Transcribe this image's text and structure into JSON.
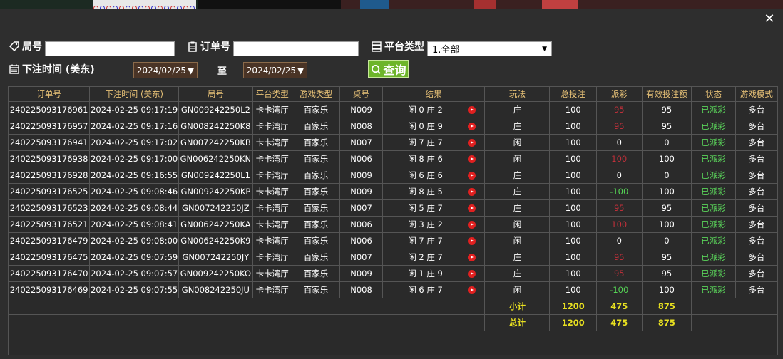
{
  "form": {
    "round_label": "局号",
    "order_label": "订单号",
    "platform_label": "平台类型",
    "platform_value": "1.全部",
    "bet_time_label": "下注时间 (美东)",
    "date_from": "2024/02/25",
    "to_label": "至",
    "date_to": "2024/02/25",
    "query_label": "查询"
  },
  "table": {
    "headers": [
      "订单号",
      "下注时间 (美东)",
      "局号",
      "平台类型",
      "游戏类型",
      "桌号",
      "结果",
      "玩法",
      "总投注",
      "派彩",
      "有效投注额",
      "状态",
      "游戏模式"
    ],
    "rows": [
      {
        "order": "240225093176961",
        "time": "2024-02-25 09:17:19",
        "round": "GN009242250L2",
        "platform": "卡卡湾厅",
        "game": "百家乐",
        "table": "N009",
        "result": "闲 0 庄 2",
        "play": "庄",
        "total": "100",
        "payout": "95",
        "payout_type": "neg",
        "valid": "95",
        "status": "已派彩",
        "mode": "多台"
      },
      {
        "order": "240225093176957",
        "time": "2024-02-25 09:17:16",
        "round": "GN008242250K8",
        "platform": "卡卡湾厅",
        "game": "百家乐",
        "table": "N008",
        "result": "闲 0 庄 9",
        "play": "庄",
        "total": "100",
        "payout": "95",
        "payout_type": "neg",
        "valid": "95",
        "status": "已派彩",
        "mode": "多台"
      },
      {
        "order": "240225093176941",
        "time": "2024-02-25 09:17:02",
        "round": "GN007242250KB",
        "platform": "卡卡湾厅",
        "game": "百家乐",
        "table": "N007",
        "result": "闲 7 庄 7",
        "play": "闲",
        "total": "100",
        "payout": "0",
        "payout_type": "plain",
        "valid": "0",
        "status": "已派彩",
        "mode": "多台"
      },
      {
        "order": "240225093176938",
        "time": "2024-02-25 09:17:00",
        "round": "GN006242250KN",
        "platform": "卡卡湾厅",
        "game": "百家乐",
        "table": "N006",
        "result": "闲 8 庄 6",
        "play": "闲",
        "total": "100",
        "payout": "100",
        "payout_type": "neg",
        "valid": "100",
        "status": "已派彩",
        "mode": "多台"
      },
      {
        "order": "240225093176928",
        "time": "2024-02-25 09:16:55",
        "round": "GN009242250L1",
        "platform": "卡卡湾厅",
        "game": "百家乐",
        "table": "N009",
        "result": "闲 6 庄 6",
        "play": "庄",
        "total": "100",
        "payout": "0",
        "payout_type": "plain",
        "valid": "0",
        "status": "已派彩",
        "mode": "多台"
      },
      {
        "order": "240225093176525",
        "time": "2024-02-25 09:08:46",
        "round": "GN009242250KP",
        "platform": "卡卡湾厅",
        "game": "百家乐",
        "table": "N009",
        "result": "闲 8 庄 5",
        "play": "庄",
        "total": "100",
        "payout": "-100",
        "payout_type": "grn",
        "valid": "100",
        "status": "已派彩",
        "mode": "多台"
      },
      {
        "order": "240225093176523",
        "time": "2024-02-25 09:08:44",
        "round": "GN007242250JZ",
        "platform": "卡卡湾厅",
        "game": "百家乐",
        "table": "N007",
        "result": "闲 5 庄 7",
        "play": "庄",
        "total": "100",
        "payout": "95",
        "payout_type": "neg",
        "valid": "95",
        "status": "已派彩",
        "mode": "多台"
      },
      {
        "order": "240225093176521",
        "time": "2024-02-25 09:08:41",
        "round": "GN006242250KA",
        "platform": "卡卡湾厅",
        "game": "百家乐",
        "table": "N006",
        "result": "闲 3 庄 2",
        "play": "闲",
        "total": "100",
        "payout": "100",
        "payout_type": "neg",
        "valid": "100",
        "status": "已派彩",
        "mode": "多台"
      },
      {
        "order": "240225093176479",
        "time": "2024-02-25 09:08:00",
        "round": "GN006242250K9",
        "platform": "卡卡湾厅",
        "game": "百家乐",
        "table": "N006",
        "result": "闲 7 庄 7",
        "play": "闲",
        "total": "100",
        "payout": "0",
        "payout_type": "plain",
        "valid": "0",
        "status": "已派彩",
        "mode": "多台"
      },
      {
        "order": "240225093176475",
        "time": "2024-02-25 09:07:59",
        "round": "GN007242250JY",
        "platform": "卡卡湾厅",
        "game": "百家乐",
        "table": "N007",
        "result": "闲 2 庄 7",
        "play": "庄",
        "total": "100",
        "payout": "95",
        "payout_type": "neg",
        "valid": "95",
        "status": "已派彩",
        "mode": "多台"
      },
      {
        "order": "240225093176470",
        "time": "2024-02-25 09:07:57",
        "round": "GN009242250KO",
        "platform": "卡卡湾厅",
        "game": "百家乐",
        "table": "N009",
        "result": "闲 1 庄 9",
        "play": "庄",
        "total": "100",
        "payout": "95",
        "payout_type": "neg",
        "valid": "95",
        "status": "已派彩",
        "mode": "多台"
      },
      {
        "order": "240225093176469",
        "time": "2024-02-25 09:07:55",
        "round": "GN008242250JU",
        "platform": "卡卡湾厅",
        "game": "百家乐",
        "table": "N008",
        "result": "闲 6 庄 7",
        "play": "闲",
        "total": "100",
        "payout": "-100",
        "payout_type": "grn",
        "valid": "100",
        "status": "已派彩",
        "mode": "多台"
      }
    ],
    "subtotal": {
      "label": "小计",
      "total": "1200",
      "payout": "475",
      "valid": "875"
    },
    "grandtotal": {
      "label": "总计",
      "total": "1200",
      "payout": "475",
      "valid": "875"
    }
  },
  "colors": {
    "header_text": "#e8c277",
    "status_green": "#5ad45a",
    "loss_red": "#c0303a",
    "sum_yellow": "#e8e020",
    "query_green": "#6db52a"
  }
}
